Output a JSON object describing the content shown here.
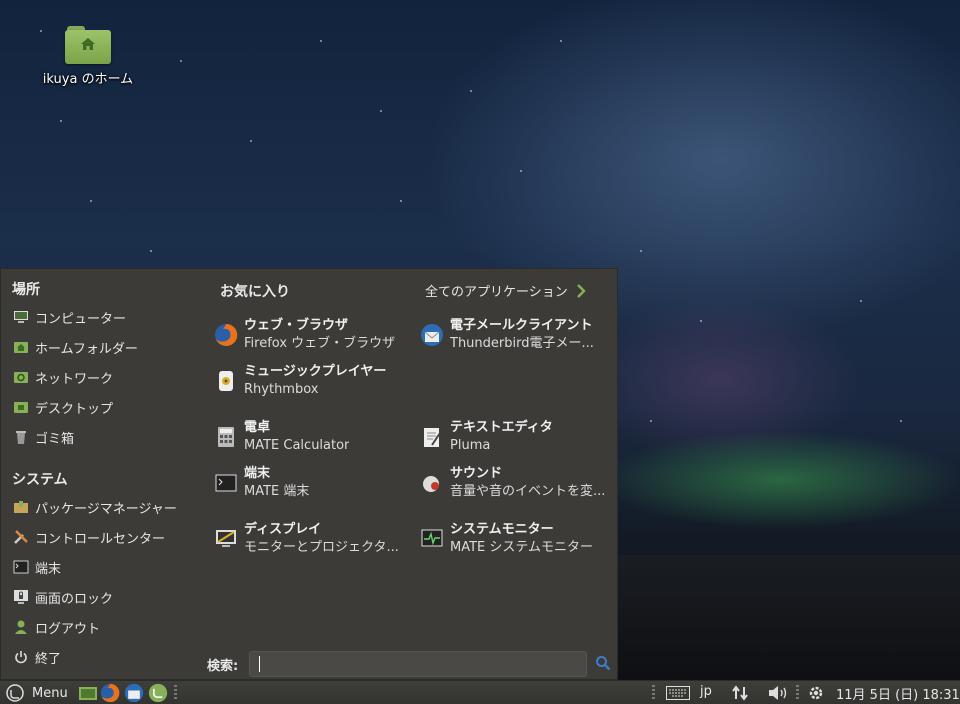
{
  "desktop": {
    "home_icon_label": "ikuya のホーム"
  },
  "menu": {
    "places_heading": "場所",
    "places": [
      {
        "label": "コンピューター",
        "icon": "computer-icon"
      },
      {
        "label": "ホームフォルダー",
        "icon": "home-folder-icon"
      },
      {
        "label": "ネットワーク",
        "icon": "network-icon"
      },
      {
        "label": "デスクトップ",
        "icon": "desktop-icon"
      },
      {
        "label": "ゴミ箱",
        "icon": "trash-icon"
      }
    ],
    "system_heading": "システム",
    "system": [
      {
        "label": "パッケージマネージャー",
        "icon": "package-icon"
      },
      {
        "label": "コントロールセンター",
        "icon": "tools-icon"
      },
      {
        "label": "端末",
        "icon": "terminal-icon"
      },
      {
        "label": "画面のロック",
        "icon": "lock-screen-icon"
      },
      {
        "label": "ログアウト",
        "icon": "logout-icon"
      },
      {
        "label": "終了",
        "icon": "power-icon"
      }
    ],
    "favorites_heading": "お気に入り",
    "all_apps_label": "全てのアプリケーション",
    "favorites": [
      {
        "name": "ウェブ・ブラウザ",
        "desc": "Firefox ウェブ・ブラウザ",
        "icon": "firefox-icon"
      },
      {
        "name": "電子メールクライアント",
        "desc": "Thunderbird電子メー...",
        "icon": "thunderbird-icon"
      },
      {
        "name": "ミュージックプレイヤー",
        "desc": "Rhythmbox",
        "icon": "rhythmbox-icon"
      },
      {
        "name": "電卓",
        "desc": "MATE Calculator",
        "icon": "calculator-icon"
      },
      {
        "name": "テキストエディタ",
        "desc": "Pluma",
        "icon": "text-editor-icon"
      },
      {
        "name": "端末",
        "desc": "MATE 端末",
        "icon": "terminal-icon"
      },
      {
        "name": "サウンド",
        "desc": "音量や音のイベントを変...",
        "icon": "sound-icon"
      },
      {
        "name": "ディスプレイ",
        "desc": "モニターとプロジェクタ...",
        "icon": "display-icon"
      },
      {
        "name": "システムモニター",
        "desc": "MATE システムモニター",
        "icon": "system-monitor-icon"
      }
    ],
    "search_label": "検索:",
    "search_value": ""
  },
  "taskbar": {
    "menu_label": "Menu",
    "keyboard_layout": "jp",
    "clock": "11月 5日 (日) 18:31"
  },
  "colors": {
    "menu_bg": "#3c3b37",
    "accent_green": "#87b158",
    "taskbar_bg": "#3a3a37"
  }
}
